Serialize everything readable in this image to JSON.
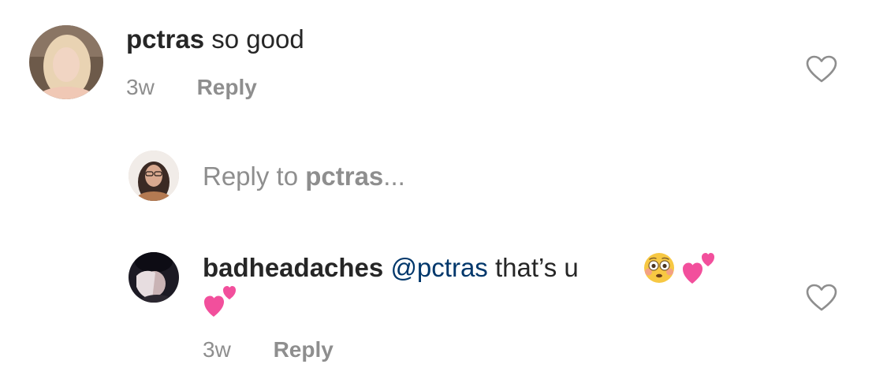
{
  "comment1": {
    "username": "pctras",
    "text": "so good",
    "time": "3w",
    "reply_label": "Reply",
    "like_icon": "heart-outline-icon"
  },
  "reply_input": {
    "prefix": "Reply to",
    "target": "pctras",
    "suffix": "..."
  },
  "comment2": {
    "username": "badheadaches",
    "mention": "@pctras",
    "text": "that’s u",
    "emoji_1": "flushed-face-emoji",
    "emoji_2": "two-hearts-emoji",
    "emoji_3": "two-hearts-emoji",
    "time": "3w",
    "reply_label": "Reply",
    "like_icon": "heart-outline-icon"
  },
  "colors": {
    "text": "#262626",
    "secondary": "#8e8e8e",
    "mention": "#00376b",
    "heart_stroke": "#8e8e8e"
  }
}
